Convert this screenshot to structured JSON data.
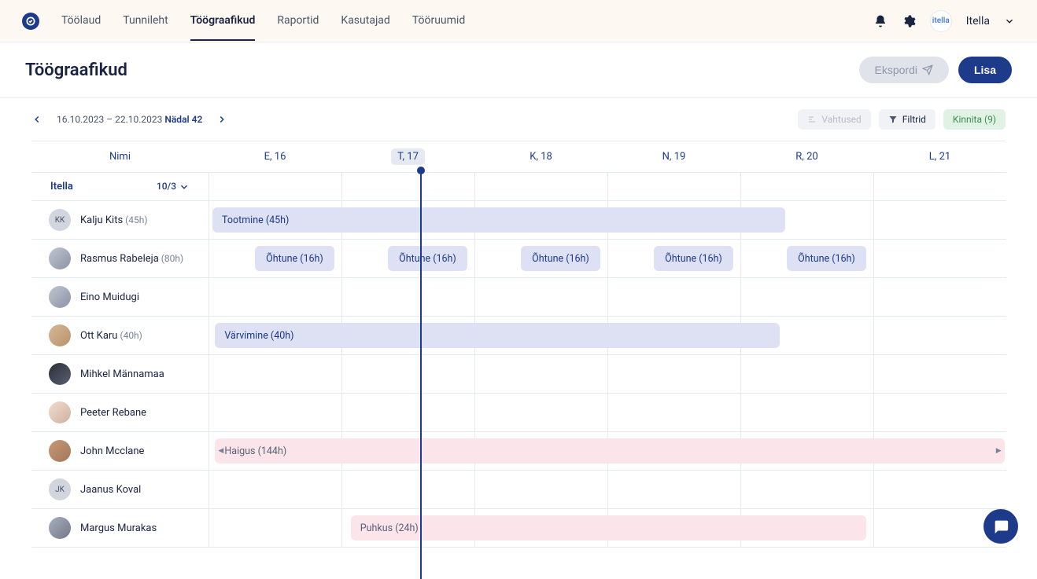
{
  "nav": {
    "items": [
      "Töölaud",
      "Tunnileht",
      "Töögraafikud",
      "Raportid",
      "Kasutajad",
      "Tööruumid"
    ],
    "active_index": 2
  },
  "org": {
    "logo_text": "itella",
    "name": "Itella"
  },
  "page": {
    "title": "Töögraafikud"
  },
  "buttons": {
    "export": "Ekspordi",
    "add": "Lisa"
  },
  "date_nav": {
    "range": "16.10.2023 – 22.10.2023",
    "week": "Nädal 42"
  },
  "chips": {
    "shifts": "Vahtused",
    "filters": "Filtrid",
    "confirm": "Kinnita (9)"
  },
  "columns": {
    "name": "Nimi",
    "days": [
      "E, 16",
      "T, 17",
      "K, 18",
      "N, 19",
      "R, 20",
      "L, 21"
    ],
    "today_index": 1
  },
  "group": {
    "name": "Itella",
    "count": "10/3"
  },
  "people": [
    {
      "initials": "KK",
      "name": "Kalju Kits",
      "hours": "(45h)",
      "avatar": "initials"
    },
    {
      "initials": "",
      "name": "Rasmus Rabeleja",
      "hours": "(80h)",
      "avatar": "photo"
    },
    {
      "initials": "",
      "name": "Eino Muidugi",
      "hours": "",
      "avatar": "photo"
    },
    {
      "initials": "",
      "name": "Ott Karu",
      "hours": "(40h)",
      "avatar": "photo"
    },
    {
      "initials": "",
      "name": "Mihkel Männamaa",
      "hours": "",
      "avatar": "photo3"
    },
    {
      "initials": "",
      "name": "Peeter Rebane",
      "hours": "",
      "avatar": "photo4"
    },
    {
      "initials": "",
      "name": "John Mcclane",
      "hours": "",
      "avatar": "photo5"
    },
    {
      "initials": "JK",
      "name": "Jaanus Koval",
      "hours": "",
      "avatar": "initials"
    },
    {
      "initials": "",
      "name": "Margus Murakas",
      "hours": "",
      "avatar": "photo6"
    }
  ],
  "entries": {
    "row0": [
      {
        "label": "Tootmine (45h)",
        "start": 0,
        "span": 4.33,
        "type": "blue"
      }
    ],
    "row1": [
      {
        "label": "Õhtune (16h)",
        "start": 0.32,
        "span": 0.62,
        "type": "short"
      },
      {
        "label": "Õhtune (16h)",
        "start": 1.32,
        "span": 0.62,
        "type": "short"
      },
      {
        "label": "Õhtune (16h)",
        "start": 2.32,
        "span": 0.62,
        "type": "short"
      },
      {
        "label": "Õhtune (16h)",
        "start": 3.32,
        "span": 0.62,
        "type": "short"
      },
      {
        "label": "Õhtune (16h)",
        "start": 4.32,
        "span": 0.62,
        "type": "short"
      }
    ],
    "row2": [],
    "row3": [
      {
        "label": "Värvimine (40h)",
        "start": 0.02,
        "span": 4.27,
        "type": "blue"
      }
    ],
    "row4": [],
    "row5": [],
    "row6": [
      {
        "label": "Haigus (144h)",
        "start": 0.02,
        "span": 5.96,
        "type": "pink",
        "arrows": true
      }
    ],
    "row7": [],
    "row8": [
      {
        "label": "Puhkus (24h)",
        "start": 1.04,
        "span": 3.9,
        "type": "pink"
      }
    ]
  }
}
